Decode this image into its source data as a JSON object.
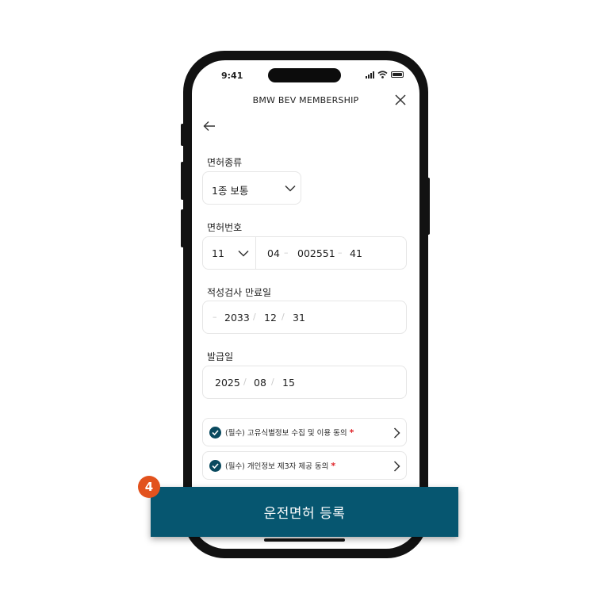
{
  "status_bar": {
    "time": "9:41"
  },
  "header": {
    "title": "BMW BEV MEMBERSHIP",
    "close_icon": "close-icon"
  },
  "nav": {
    "back_icon": "arrow-left-icon"
  },
  "license_type": {
    "label": "면허종류",
    "value": "1종 보통"
  },
  "license_number": {
    "label": "면허번호",
    "region": "11",
    "part1": "04",
    "part2": "002551",
    "part3": "41",
    "separator": "–"
  },
  "aptitude_expiry": {
    "label": "적성검사 만료일",
    "prefix": "–",
    "year": "2033",
    "month": "12",
    "day": "31",
    "separator": "/"
  },
  "issue_date": {
    "label": "발급일",
    "year": "2025",
    "month": "08",
    "day": "15",
    "separator": "/"
  },
  "agreements": [
    {
      "text": "(필수) 고유식별정보 수집 및 이용 동의",
      "required_mark": "*",
      "checked": true
    },
    {
      "text": "(필수) 개인정보 제3자 제공 동의",
      "required_mark": "*",
      "checked": true
    }
  ],
  "cta": {
    "label": "운전면허 등록"
  },
  "step_badge": {
    "number": "4"
  },
  "colors": {
    "accent": "#065670",
    "check": "#0a4a5f",
    "badge": "#e2521d",
    "required": "#e0252a"
  }
}
